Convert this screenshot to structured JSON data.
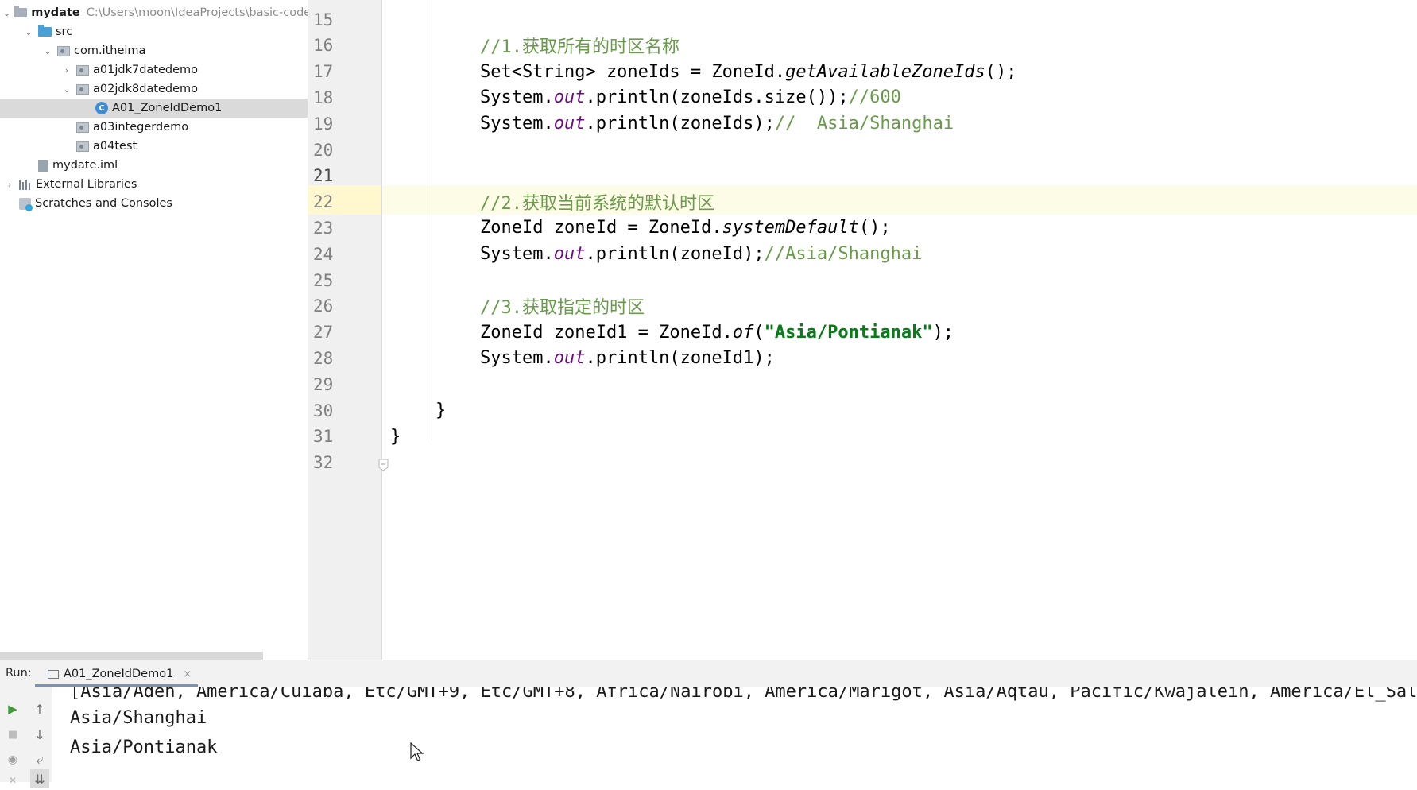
{
  "project_tree": {
    "rows": [
      {
        "label": "mydate",
        "extra": "C:\\Users\\moon\\IdeaProjects\\basic-code",
        "icon": "folder-icon"
      },
      {
        "label": "src",
        "icon": "source-folder-icon"
      },
      {
        "label": "com.itheima",
        "icon": "package-icon"
      },
      {
        "label": "a01jdk7datedemo",
        "icon": "package-icon"
      },
      {
        "label": "a02jdk8datedemo",
        "icon": "package-icon"
      },
      {
        "label": "A01_ZoneIdDemo1",
        "icon": "class-icon",
        "icon_letter": "C"
      },
      {
        "label": "a03integerdemo",
        "icon": "package-icon"
      },
      {
        "label": "a04test",
        "icon": "package-icon"
      },
      {
        "label": "mydate.iml",
        "icon": "iml-file-icon"
      },
      {
        "label": "External Libraries",
        "icon": "library-icon"
      },
      {
        "label": "Scratches and Consoles",
        "icon": "scratch-icon"
      }
    ],
    "selected": "A01_ZoneIdDemo1"
  },
  "editor": {
    "current_line": "21",
    "lines": [
      {
        "n": "15",
        "segments": []
      },
      {
        "n": "16",
        "segments": [
          {
            "t": "//1.获取所有的时区名称",
            "c": "cm"
          }
        ]
      },
      {
        "n": "17",
        "segments": [
          {
            "t": "Set<String> zoneIds = ZoneId."
          },
          {
            "t": "getAvailableZoneIds",
            "c": "ital"
          },
          {
            "t": "();"
          }
        ]
      },
      {
        "n": "18",
        "segments": [
          {
            "t": "System."
          },
          {
            "t": "out",
            "c": "fld"
          },
          {
            "t": ".println(zoneIds.size());"
          },
          {
            "t": "//600",
            "c": "cm"
          }
        ]
      },
      {
        "n": "19",
        "segments": [
          {
            "t": "System."
          },
          {
            "t": "out",
            "c": "fld"
          },
          {
            "t": ".println(zoneIds);"
          },
          {
            "t": "//  Asia/Shanghai",
            "c": "cm"
          }
        ]
      },
      {
        "n": "20",
        "segments": []
      },
      {
        "n": "21",
        "segments": []
      },
      {
        "n": "22",
        "segments": [
          {
            "t": "//2.获取当前系统的默认时区",
            "c": "cm"
          }
        ]
      },
      {
        "n": "23",
        "segments": [
          {
            "t": "ZoneId zoneId = ZoneId."
          },
          {
            "t": "systemDefault",
            "c": "ital"
          },
          {
            "t": "();"
          }
        ]
      },
      {
        "n": "24",
        "segments": [
          {
            "t": "System."
          },
          {
            "t": "out",
            "c": "fld"
          },
          {
            "t": ".println(zoneId);"
          },
          {
            "t": "//Asia/Shanghai",
            "c": "cm"
          }
        ]
      },
      {
        "n": "25",
        "segments": []
      },
      {
        "n": "26",
        "segments": [
          {
            "t": "//3.获取指定的时区",
            "c": "cm"
          }
        ]
      },
      {
        "n": "27",
        "segments": [
          {
            "t": "ZoneId zoneId1 = ZoneId."
          },
          {
            "t": "of",
            "c": "ital"
          },
          {
            "t": "("
          },
          {
            "t": "\"Asia/Pontianak\"",
            "c": "str"
          },
          {
            "t": ");"
          }
        ]
      },
      {
        "n": "28",
        "segments": [
          {
            "t": "System."
          },
          {
            "t": "out",
            "c": "fld"
          },
          {
            "t": ".println(zoneId1);"
          }
        ]
      },
      {
        "n": "29",
        "segments": []
      },
      {
        "n": "30",
        "segments": [
          {
            "t": "}"
          }
        ],
        "indent": "method"
      },
      {
        "n": "31",
        "segments": [
          {
            "t": "}"
          }
        ],
        "indent": "class"
      },
      {
        "n": "32",
        "segments": []
      }
    ]
  },
  "run_panel": {
    "title": "Run:",
    "tab_label": "A01_ZoneIdDemo1",
    "close_glyph": "×",
    "output": [
      "[Asia/Aden, America/Cuiaba, Etc/GMT+9, Etc/GMT+8, Africa/Nairobi, America/Marigot, Asia/Aqtau, Pacific/Kwajalein, America/El_Salvador, Asia/Pontianak",
      "Asia/Shanghai",
      "Asia/Pontianak"
    ],
    "toolbar": {
      "run_glyph": "▶",
      "stop_glyph": "■",
      "up_glyph": "↑",
      "down_glyph": "↓",
      "wrap_glyph": "⤶",
      "camera_glyph": "◉",
      "scroll_end_glyph": "⇊",
      "close_glyph": "✕"
    }
  },
  "colors": {
    "comment": "#6a9a4b",
    "static_field": "#660e7a",
    "string": "#067d17",
    "current_line": "#fdfce6",
    "run_green": "#3d9b3a"
  }
}
